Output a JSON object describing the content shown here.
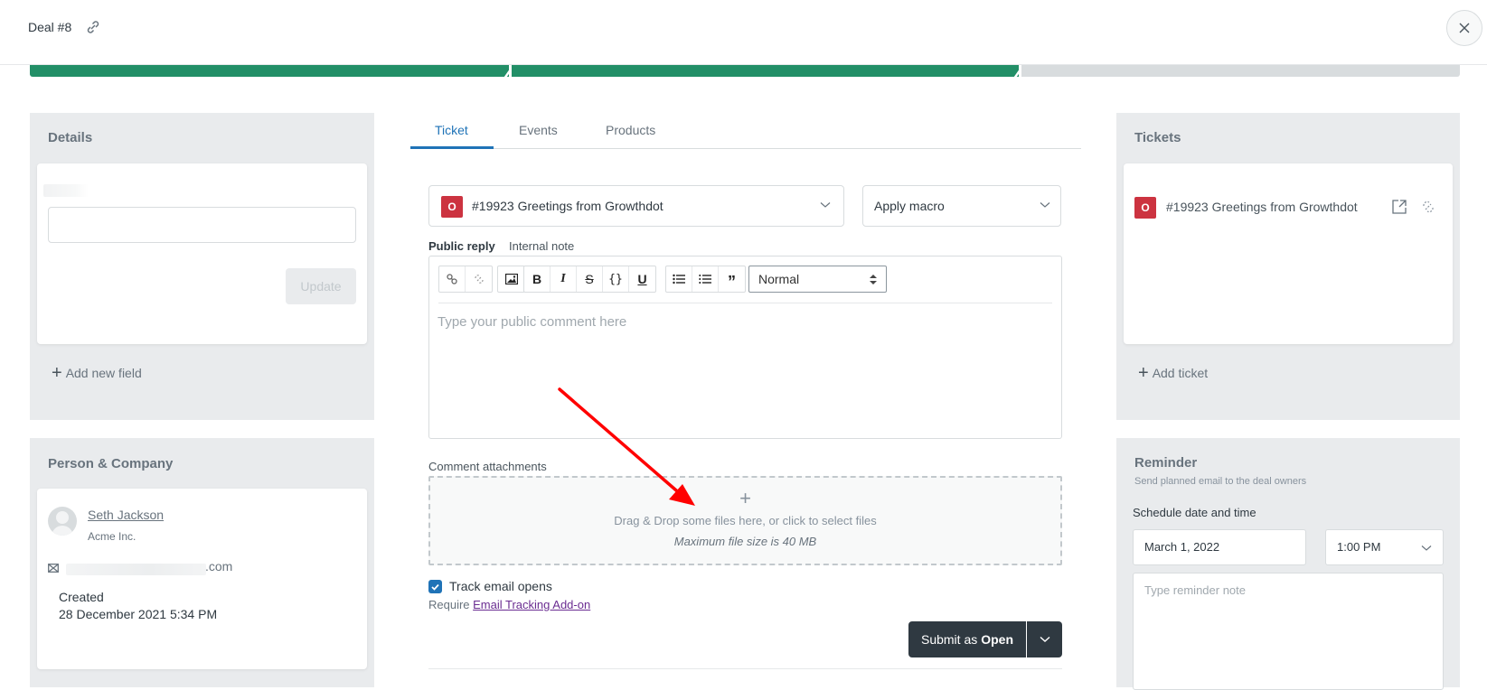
{
  "header": {
    "title": "Deal #8",
    "link_icon": "link-icon",
    "close_icon": "close-icon"
  },
  "pipeline": {
    "stages_completed": 2,
    "stages_total": 3
  },
  "details": {
    "title": "Details",
    "field_value": "",
    "update_label": "Update",
    "add_field_label": "Add new field"
  },
  "person_company": {
    "title": "Person & Company",
    "name": "Seth Jackson",
    "company": "Acme Inc.",
    "email_suffix": ".com",
    "email_icon": "envelope-icon",
    "created_label": "Created",
    "created_value": "28 December 2021 5:34 PM"
  },
  "tabs": [
    {
      "label": "Ticket",
      "active": true
    },
    {
      "label": "Events",
      "active": false
    },
    {
      "label": "Products",
      "active": false
    }
  ],
  "ticket_select": {
    "status_letter": "O",
    "status_color": "#cc3340",
    "text": "#19923  Greetings from Growthdot"
  },
  "macro_select": {
    "label": "Apply macro"
  },
  "reply_tabs": {
    "public": "Public reply",
    "internal": "Internal note"
  },
  "editor": {
    "toolbar_groups": [
      [
        "link-icon",
        "unlink-icon"
      ],
      [
        "image-icon"
      ],
      [
        "bold-icon",
        "italic-icon",
        "strikethrough-icon",
        "code-icon",
        "underline-icon"
      ],
      [
        "bullet-list-icon",
        "numbered-list-icon",
        "quote-icon"
      ]
    ],
    "heading_select": "Normal",
    "placeholder": "Type your public comment here"
  },
  "attachments": {
    "label": "Comment attachments",
    "drop_text": "Drag & Drop some files here, or click to select files",
    "max_size": "Maximum file size is 40 MB"
  },
  "tracking": {
    "checked": true,
    "label": "Track email opens",
    "require_prefix": "Require ",
    "require_link": "Email Tracking Add-on"
  },
  "submit": {
    "prefix": "Submit as",
    "status": "Open"
  },
  "tickets_panel": {
    "title": "Tickets",
    "items": [
      {
        "status_letter": "O",
        "text": "#19923  Greetings from Growthdot"
      }
    ],
    "add_label": "Add ticket"
  },
  "reminder": {
    "title": "Reminder",
    "subtitle": "Send planned email to the deal owners",
    "schedule_label": "Schedule date and time",
    "date": "March 1, 2022",
    "time": "1:00 PM",
    "note_placeholder": "Type reminder note"
  },
  "colors": {
    "accent": "#1f73b7",
    "pipeline_done": "#228f67",
    "pipeline_todo": "#d8dcde",
    "submit_bg": "#2f3941",
    "annotation_arrow": "#ff0000"
  }
}
